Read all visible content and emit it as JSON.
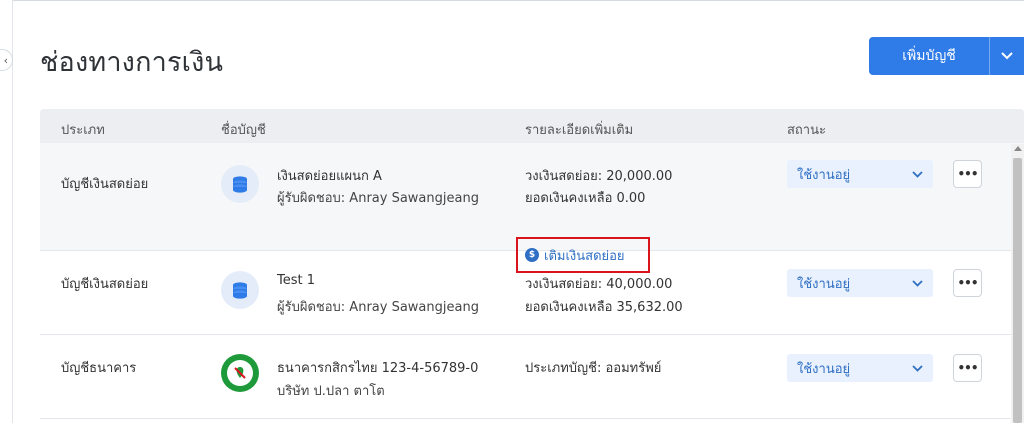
{
  "page": {
    "title": "ช่องทางการเงิน",
    "add_button_label": "เพิ่มบัญชี"
  },
  "icons": {
    "collapse": "chevron-left-icon",
    "dropdown": "chevron-down-icon",
    "coins": "coins-icon",
    "bank": "kasikorn-bank-logo-icon",
    "topup": "coin-circle-icon",
    "more": "ellipsis-icon"
  },
  "colors": {
    "primary": "#2f7be8",
    "status_bg": "#e8f1fd",
    "highlight_border": "#d9141c",
    "bank_green": "#1f9a3a"
  },
  "table": {
    "headers": {
      "type": "ประเภท",
      "account_name": "ชื่อบัญชี",
      "details": "รายละเอียดเพิ่มเติม",
      "status": "สถานะ"
    },
    "rows": [
      {
        "type": "บัญชีเงินสดย่อย",
        "name": "เงินสดย่อยแผนก A",
        "sub": "ผู้รับผิดชอบ: Anray Sawangjeang",
        "detail1": "วงเงินสดย่อย: 20,000.00",
        "detail2": "ยอดเงินคงเหลือ 0.00",
        "action": "เติมเงินสดย่อย",
        "status": "ใช้งานอยู่",
        "more": "•••"
      },
      {
        "type": "บัญชีเงินสดย่อย",
        "name": "Test 1",
        "sub": "ผู้รับผิดชอบ: Anray Sawangjeang",
        "detail1": "วงเงินสดย่อย: 40,000.00",
        "detail2": "ยอดเงินคงเหลือ 35,632.00",
        "status": "ใช้งานอยู่",
        "more": "•••"
      },
      {
        "type": "บัญชีธนาคาร",
        "name": "ธนาคารกสิกรไทย 123-4-56789-0",
        "sub": "บริษัท ป.ปลา ตาโต",
        "detail1": "ประเภทบัญชี: ออมทรัพย์",
        "status": "ใช้งานอยู่",
        "more": "•••"
      }
    ]
  }
}
